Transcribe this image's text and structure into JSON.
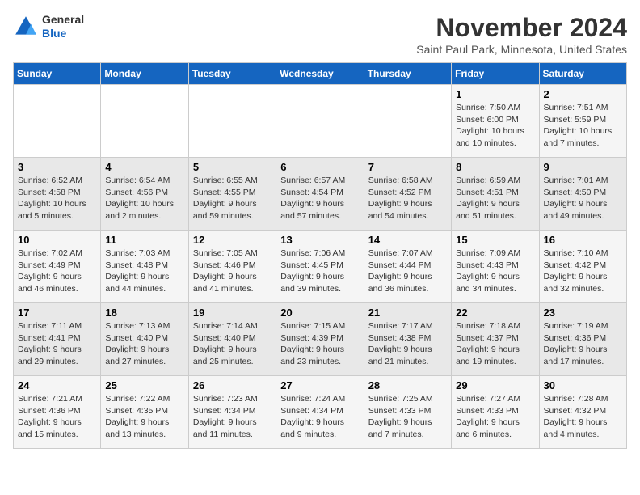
{
  "header": {
    "logo_line1": "General",
    "logo_line2": "Blue",
    "month_title": "November 2024",
    "location": "Saint Paul Park, Minnesota, United States"
  },
  "weekdays": [
    "Sunday",
    "Monday",
    "Tuesday",
    "Wednesday",
    "Thursday",
    "Friday",
    "Saturday"
  ],
  "weeks": [
    [
      {
        "day": "",
        "info": ""
      },
      {
        "day": "",
        "info": ""
      },
      {
        "day": "",
        "info": ""
      },
      {
        "day": "",
        "info": ""
      },
      {
        "day": "",
        "info": ""
      },
      {
        "day": "1",
        "info": "Sunrise: 7:50 AM\nSunset: 6:00 PM\nDaylight: 10 hours and 10 minutes."
      },
      {
        "day": "2",
        "info": "Sunrise: 7:51 AM\nSunset: 5:59 PM\nDaylight: 10 hours and 7 minutes."
      }
    ],
    [
      {
        "day": "3",
        "info": "Sunrise: 6:52 AM\nSunset: 4:58 PM\nDaylight: 10 hours and 5 minutes."
      },
      {
        "day": "4",
        "info": "Sunrise: 6:54 AM\nSunset: 4:56 PM\nDaylight: 10 hours and 2 minutes."
      },
      {
        "day": "5",
        "info": "Sunrise: 6:55 AM\nSunset: 4:55 PM\nDaylight: 9 hours and 59 minutes."
      },
      {
        "day": "6",
        "info": "Sunrise: 6:57 AM\nSunset: 4:54 PM\nDaylight: 9 hours and 57 minutes."
      },
      {
        "day": "7",
        "info": "Sunrise: 6:58 AM\nSunset: 4:52 PM\nDaylight: 9 hours and 54 minutes."
      },
      {
        "day": "8",
        "info": "Sunrise: 6:59 AM\nSunset: 4:51 PM\nDaylight: 9 hours and 51 minutes."
      },
      {
        "day": "9",
        "info": "Sunrise: 7:01 AM\nSunset: 4:50 PM\nDaylight: 9 hours and 49 minutes."
      }
    ],
    [
      {
        "day": "10",
        "info": "Sunrise: 7:02 AM\nSunset: 4:49 PM\nDaylight: 9 hours and 46 minutes."
      },
      {
        "day": "11",
        "info": "Sunrise: 7:03 AM\nSunset: 4:48 PM\nDaylight: 9 hours and 44 minutes."
      },
      {
        "day": "12",
        "info": "Sunrise: 7:05 AM\nSunset: 4:46 PM\nDaylight: 9 hours and 41 minutes."
      },
      {
        "day": "13",
        "info": "Sunrise: 7:06 AM\nSunset: 4:45 PM\nDaylight: 9 hours and 39 minutes."
      },
      {
        "day": "14",
        "info": "Sunrise: 7:07 AM\nSunset: 4:44 PM\nDaylight: 9 hours and 36 minutes."
      },
      {
        "day": "15",
        "info": "Sunrise: 7:09 AM\nSunset: 4:43 PM\nDaylight: 9 hours and 34 minutes."
      },
      {
        "day": "16",
        "info": "Sunrise: 7:10 AM\nSunset: 4:42 PM\nDaylight: 9 hours and 32 minutes."
      }
    ],
    [
      {
        "day": "17",
        "info": "Sunrise: 7:11 AM\nSunset: 4:41 PM\nDaylight: 9 hours and 29 minutes."
      },
      {
        "day": "18",
        "info": "Sunrise: 7:13 AM\nSunset: 4:40 PM\nDaylight: 9 hours and 27 minutes."
      },
      {
        "day": "19",
        "info": "Sunrise: 7:14 AM\nSunset: 4:40 PM\nDaylight: 9 hours and 25 minutes."
      },
      {
        "day": "20",
        "info": "Sunrise: 7:15 AM\nSunset: 4:39 PM\nDaylight: 9 hours and 23 minutes."
      },
      {
        "day": "21",
        "info": "Sunrise: 7:17 AM\nSunset: 4:38 PM\nDaylight: 9 hours and 21 minutes."
      },
      {
        "day": "22",
        "info": "Sunrise: 7:18 AM\nSunset: 4:37 PM\nDaylight: 9 hours and 19 minutes."
      },
      {
        "day": "23",
        "info": "Sunrise: 7:19 AM\nSunset: 4:36 PM\nDaylight: 9 hours and 17 minutes."
      }
    ],
    [
      {
        "day": "24",
        "info": "Sunrise: 7:21 AM\nSunset: 4:36 PM\nDaylight: 9 hours and 15 minutes."
      },
      {
        "day": "25",
        "info": "Sunrise: 7:22 AM\nSunset: 4:35 PM\nDaylight: 9 hours and 13 minutes."
      },
      {
        "day": "26",
        "info": "Sunrise: 7:23 AM\nSunset: 4:34 PM\nDaylight: 9 hours and 11 minutes."
      },
      {
        "day": "27",
        "info": "Sunrise: 7:24 AM\nSunset: 4:34 PM\nDaylight: 9 hours and 9 minutes."
      },
      {
        "day": "28",
        "info": "Sunrise: 7:25 AM\nSunset: 4:33 PM\nDaylight: 9 hours and 7 minutes."
      },
      {
        "day": "29",
        "info": "Sunrise: 7:27 AM\nSunset: 4:33 PM\nDaylight: 9 hours and 6 minutes."
      },
      {
        "day": "30",
        "info": "Sunrise: 7:28 AM\nSunset: 4:32 PM\nDaylight: 9 hours and 4 minutes."
      }
    ]
  ]
}
